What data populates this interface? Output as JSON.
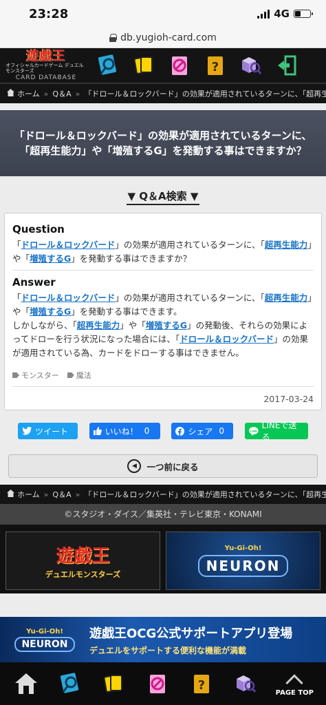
{
  "status": {
    "time": "23:28",
    "network": "4G"
  },
  "browser": {
    "url": "db.yugioh-card.com"
  },
  "header": {
    "logo_line1": "遊戯王",
    "logo_line2": "オフィシャルカードゲーム デュエルモンスターズ",
    "logo_line3": "CARD DATABASE",
    "nav_icons": [
      "card-search-icon",
      "deck-icon",
      "forbidden-icon",
      "faq-icon",
      "cube-search-icon",
      "login-icon"
    ]
  },
  "breadcrumb": {
    "home": "ホーム",
    "qa": "Q＆A",
    "current": "「ドロール＆ロックバード」の効果が適用されているターンに、「超再生",
    "current2": "「ドロール＆ロックバード」の効果が適用されているターンに、「超再生..."
  },
  "page_title": "「ドロール＆ロックバード」の効果が適用されているターンに、「超再生能力」や「増殖するG」を発動する事はできますか？",
  "qa_search_label": "▼ Q＆A検索 ▼",
  "question": {
    "heading": "Question",
    "q": "「",
    "link1": "ドロール＆ロックバード",
    "t1": "」の効果が適用されているターンに、「",
    "link2": "超再生能力",
    "t2": "」や「",
    "link3": "増殖するG",
    "t3": "」を発動する事はできますか？"
  },
  "answer": {
    "heading": "Answer",
    "q": "「",
    "link1": "ドロール＆ロックバード",
    "t1": "」の効果が適用されているターンに、「",
    "link2": "超再生能力",
    "t2": "」や「",
    "link3": "増殖するG",
    "t3": "」を発動する事はできます。",
    "t4": "しかしながら、「",
    "link4": "超再生能力",
    "t5": "」や「",
    "link5": "増殖するG",
    "t6": "」の発動後、それらの効果によってドローを行う状況になった場合には、「",
    "link6": "ドロール＆ロックバード",
    "t7": "」の効果が適用されている為、カードをドローする事はできません。"
  },
  "tags": [
    "モンスター",
    "魔法"
  ],
  "date": "2017-03-24",
  "share": {
    "tweet": "ツイート",
    "like": "いいね！",
    "like_count": "0",
    "share": "シェア",
    "share_count": "0",
    "line": "LINEで送る"
  },
  "back_label": "一つ前に戻る",
  "copyright": "©スタジオ・ダイス／集英社・テレビ東京・KONAMI",
  "banners": {
    "ocg_title": "遊戯王",
    "ocg_sub": "デュエルモンスターズ",
    "neuron_small": "Yu-Gi-Oh!",
    "neuron": "NEURON"
  },
  "promo": {
    "badge_small": "Yu-Gi-Oh!",
    "badge": "NEURON",
    "title": "遊戯王OCG公式サポートアプリ登場",
    "subtitle": "デュエルをサポートする便利な機能が満載"
  },
  "bottom_nav": {
    "pagetop": "PAGE TOP"
  },
  "colors": {
    "link": "#1a73c8",
    "title_band": "#474c5a",
    "twitter": "#1da1f2",
    "facebook": "#1877f2",
    "line": "#06c755"
  }
}
